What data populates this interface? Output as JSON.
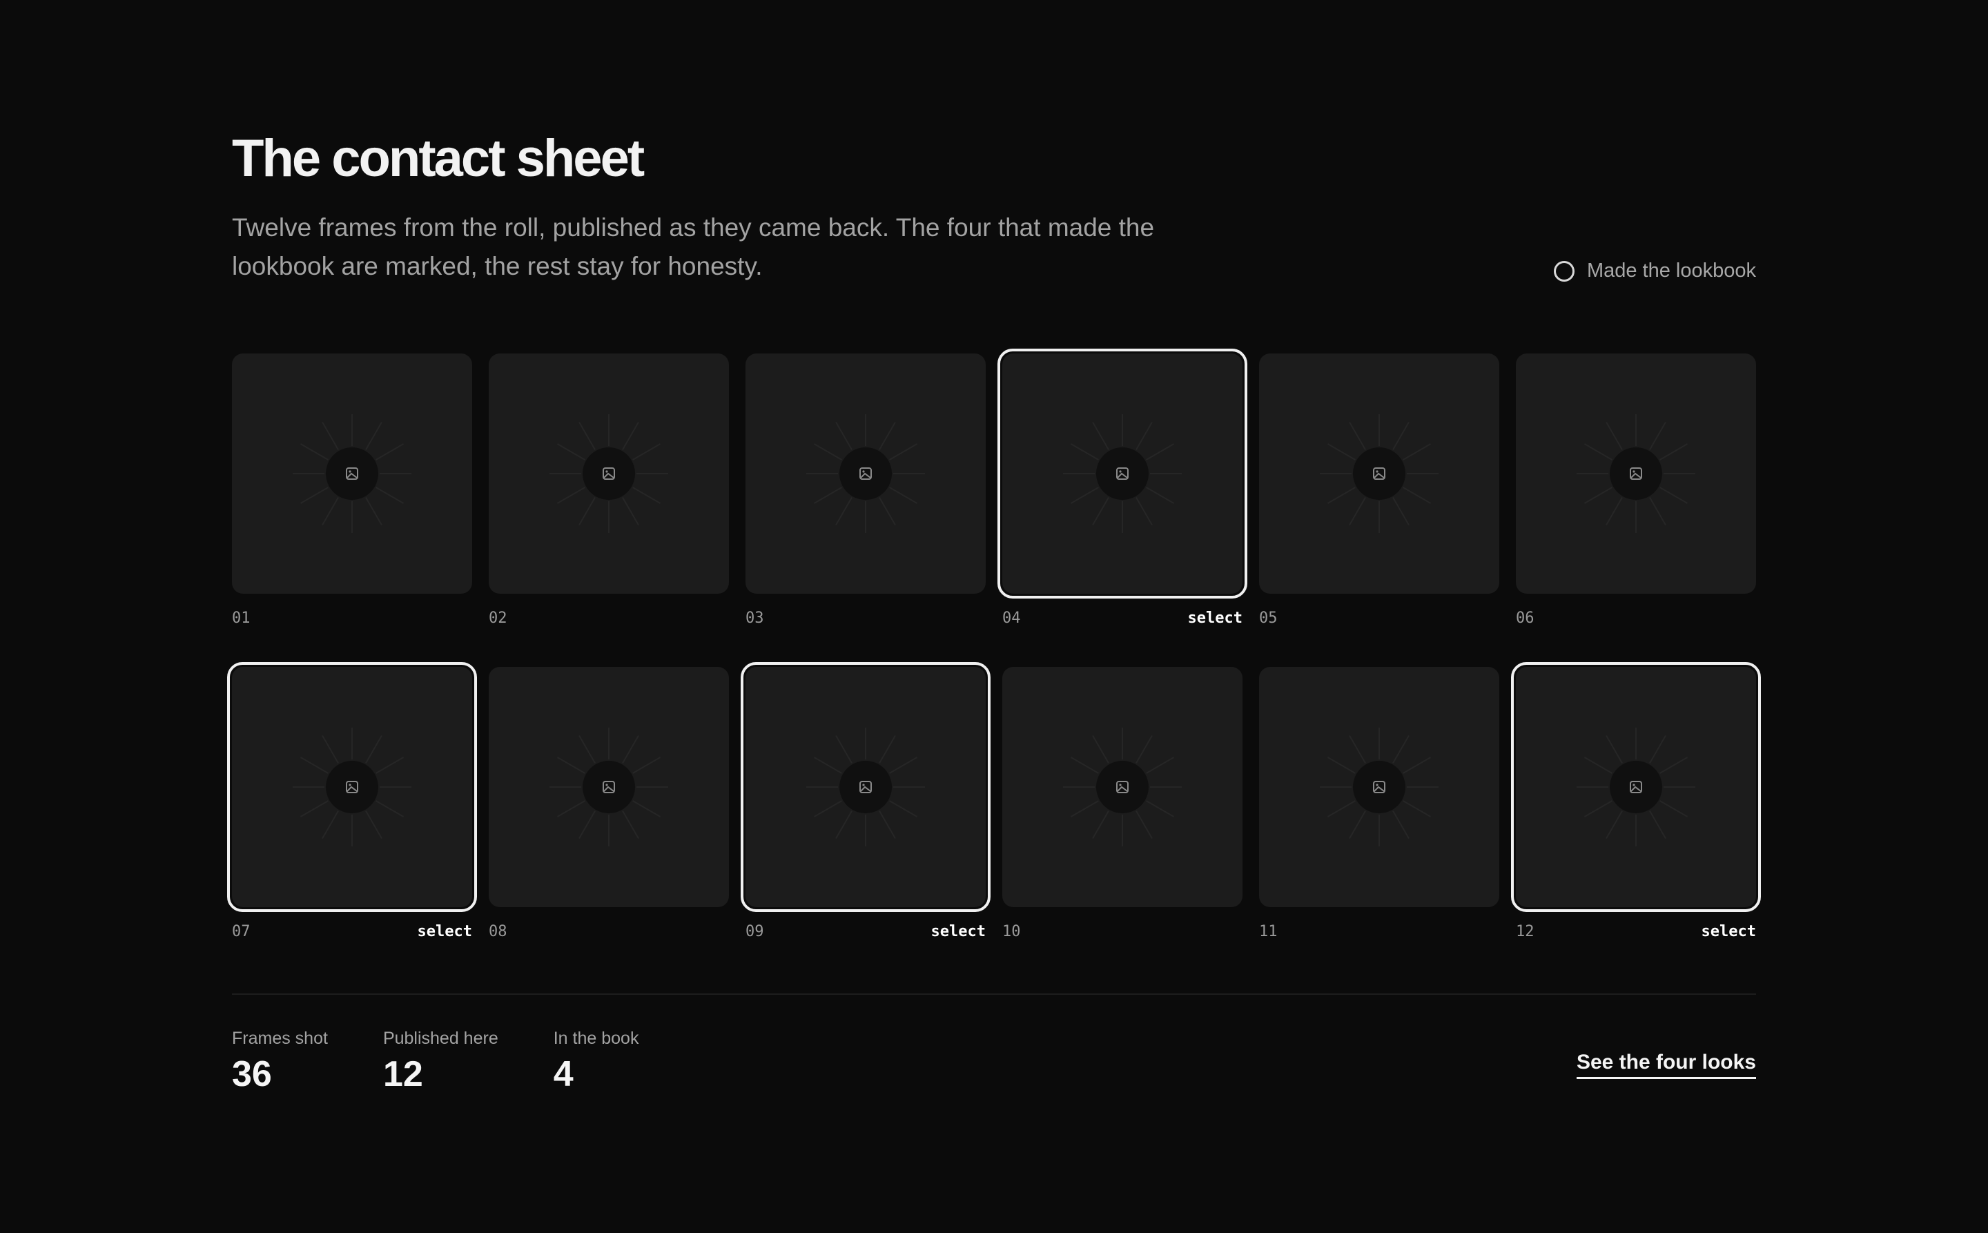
{
  "header": {
    "title": "The contact sheet",
    "subtitle": "Twelve frames from the roll, published as they came back. The four that made the lookbook are marked, the rest stay for honesty."
  },
  "legend": {
    "icon": "ring-icon",
    "label": "Made the lookbook"
  },
  "frames": [
    {
      "number": "01",
      "selected": false,
      "tag": ""
    },
    {
      "number": "02",
      "selected": false,
      "tag": ""
    },
    {
      "number": "03",
      "selected": false,
      "tag": ""
    },
    {
      "number": "04",
      "selected": true,
      "tag": "select"
    },
    {
      "number": "05",
      "selected": false,
      "tag": ""
    },
    {
      "number": "06",
      "selected": false,
      "tag": ""
    },
    {
      "number": "07",
      "selected": true,
      "tag": "select"
    },
    {
      "number": "08",
      "selected": false,
      "tag": ""
    },
    {
      "number": "09",
      "selected": true,
      "tag": "select"
    },
    {
      "number": "10",
      "selected": false,
      "tag": ""
    },
    {
      "number": "11",
      "selected": false,
      "tag": ""
    },
    {
      "number": "12",
      "selected": true,
      "tag": "select"
    }
  ],
  "stats": [
    {
      "label": "Frames shot",
      "value": "36"
    },
    {
      "label": "Published here",
      "value": "12"
    },
    {
      "label": "In the book",
      "value": "4"
    }
  ],
  "cta": {
    "label": "See the four looks"
  },
  "colors": {
    "background": "#0b0b0b",
    "tile": "#1c1c1c",
    "selected_border": "#f0f0f0",
    "muted_text": "#a3a3a3"
  }
}
